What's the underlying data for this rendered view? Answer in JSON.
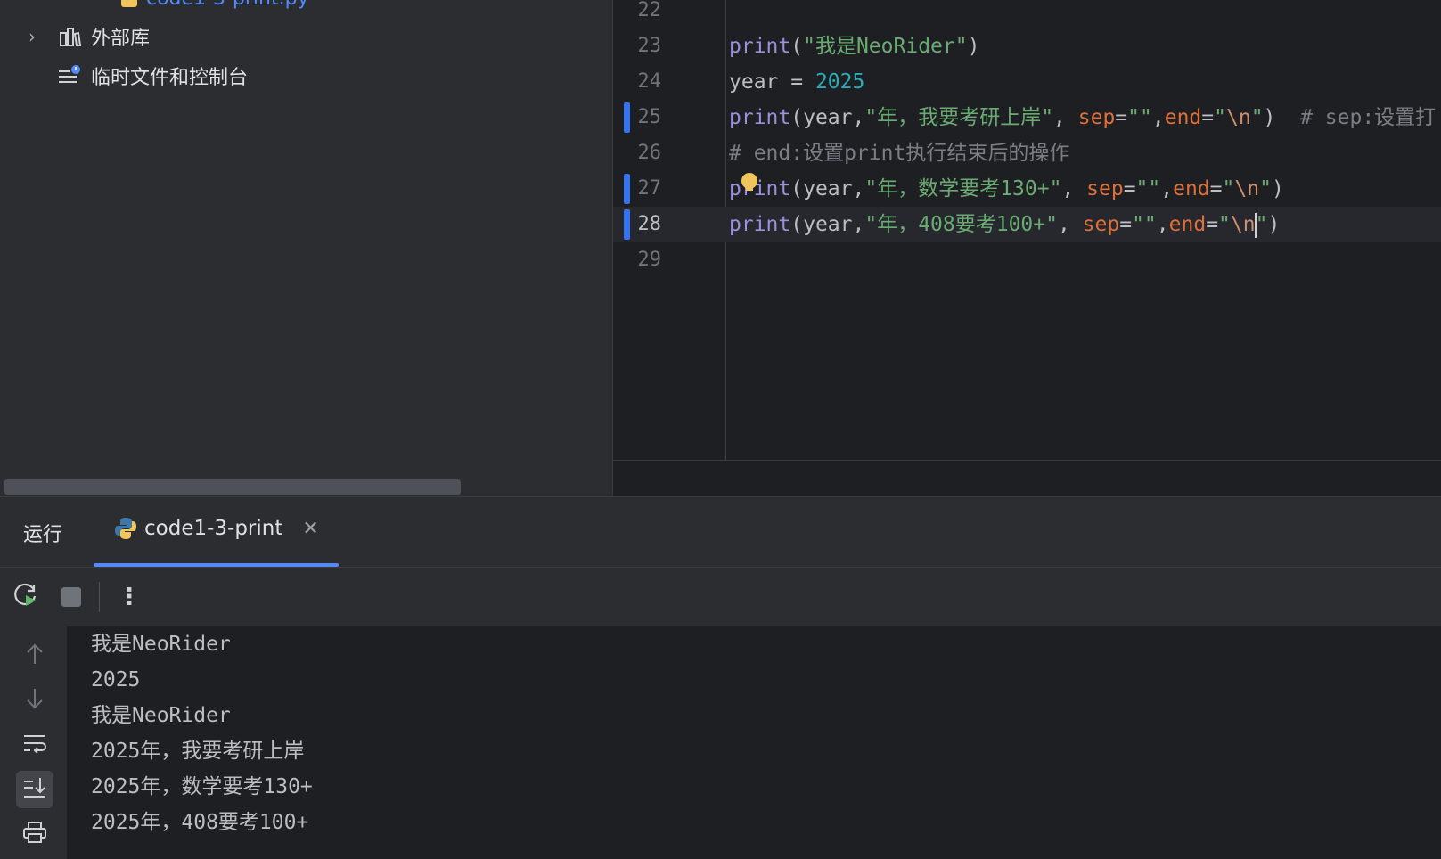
{
  "project": {
    "partial_file": "code1-3-print.py",
    "items": [
      {
        "label": "外部库",
        "icon": "library-icon"
      },
      {
        "label": "临时文件和控制台",
        "icon": "scratches-console-icon"
      }
    ]
  },
  "editor": {
    "line_numbers": [
      "22",
      "23",
      "24",
      "25",
      "26",
      "27",
      "28",
      "29"
    ],
    "lines": {
      "l23": {
        "fn": "print",
        "open": "(",
        "str": "\"我是NeoRider\"",
        "close": ")"
      },
      "l24": {
        "var": "year = ",
        "num": "2025"
      },
      "l25": {
        "fn": "print",
        "open": "(year,",
        "str": "\"年，我要考研上岸\"",
        "comma": ", ",
        "p1": "sep",
        "eq1": "=",
        "s1": "\"\"",
        "c2": ",",
        "p2": "end",
        "eq2": "=",
        "q1": "\"",
        "esc": "\\n",
        "q2": "\"",
        "close": ")",
        "cmt": "  # sep:设置打"
      },
      "l26": {
        "cmt": "# end:设置print执行结束后的操作"
      },
      "l27": {
        "fn": "print",
        "open": "(year,",
        "str": "\"年，数学要考130+\"",
        "comma": ", ",
        "p1": "sep",
        "eq1": "=",
        "s1": "\"\"",
        "c2": ",",
        "p2": "end",
        "eq2": "=",
        "q1": "\"",
        "esc": "\\n",
        "q2": "\"",
        "close": ")"
      },
      "l28": {
        "fn": "print",
        "open": "(year,",
        "str": "\"年，408要考100+\"",
        "comma": ", ",
        "p1": "sep",
        "eq1": "=",
        "s1": "\"\"",
        "c2": ",",
        "p2": "end",
        "eq2": "=",
        "q1": "\"",
        "esc": "\\n",
        "q2": "\"",
        "close": ")"
      }
    }
  },
  "run": {
    "title": "运行",
    "tab_label": "code1-3-print",
    "output": [
      "我是NeoRider",
      "2025",
      "我是NeoRider",
      "2025年，我要考研上岸",
      "2025年，数学要考130+",
      "2025年，408要考100+"
    ]
  },
  "colors": {
    "accent": "#548af7",
    "function": "#9b8fdf",
    "string": "#6aab73",
    "number": "#2aacb8",
    "named_param": "#dd6f3a",
    "comment": "#7a7e85"
  }
}
